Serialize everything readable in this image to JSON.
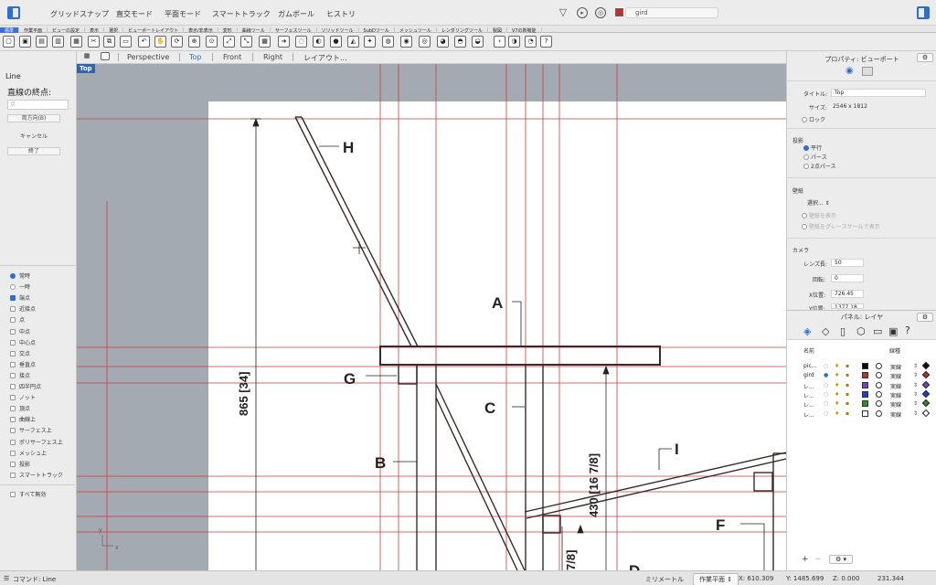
{
  "menubar": {
    "items": [
      "グリッドスナップ",
      "直交モード",
      "平面モード",
      "スマートトラック",
      "ガムボール",
      "ヒストリ"
    ],
    "layer_name": "gird",
    "layer_color": "#c0302a"
  },
  "tabs": [
    "標準",
    "作業平面",
    "ビューの設定",
    "表示",
    "選択",
    "ビューポートレイアウト",
    "表示/非表示",
    "変形",
    "曲線ツール",
    "サーフェスツール",
    "ソリッドツール",
    "SubDツール",
    "メッシュツール",
    "レンダリングツール",
    "製図",
    "V7の新機能"
  ],
  "active_tab_index": 0,
  "viewport_tabs": [
    "Perspective",
    "Top",
    "Front",
    "Right",
    "レイアウト..."
  ],
  "active_viewport_tab": 1,
  "viewport_label": "Top",
  "command_panel": {
    "title": "Line",
    "prompt": "直線の終点:",
    "input_placeholder": "点",
    "both_sides": "両方向(B)",
    "cancel": "キャンセル",
    "finish": "終了"
  },
  "osnaps": [
    {
      "label": "常時",
      "kind": "radio",
      "on": true
    },
    {
      "label": "一時",
      "kind": "radio",
      "on": false
    },
    {
      "label": "端点",
      "kind": "check",
      "on": true
    },
    {
      "label": "近接点",
      "kind": "check",
      "on": false
    },
    {
      "label": "点",
      "kind": "check",
      "on": false
    },
    {
      "label": "中点",
      "kind": "check",
      "on": false
    },
    {
      "label": "中心点",
      "kind": "check",
      "on": false
    },
    {
      "label": "交点",
      "kind": "check",
      "on": false
    },
    {
      "label": "垂直点",
      "kind": "check",
      "on": false
    },
    {
      "label": "接点",
      "kind": "check",
      "on": false
    },
    {
      "label": "四半円点",
      "kind": "check",
      "on": false
    },
    {
      "label": "ノット",
      "kind": "check",
      "on": false
    },
    {
      "label": "頂点",
      "kind": "check",
      "on": false
    },
    {
      "label": "曲線上",
      "kind": "check",
      "on": false
    },
    {
      "label": "サーフェス上",
      "kind": "check",
      "on": false
    },
    {
      "label": "ポリサーフェス上",
      "kind": "check",
      "on": false
    },
    {
      "label": "メッシュ上",
      "kind": "check",
      "on": false
    },
    {
      "label": "投影",
      "kind": "check",
      "on": false
    },
    {
      "label": "スマートトラック",
      "kind": "check",
      "on": false
    }
  ],
  "disable_all": "すべて無効",
  "properties": {
    "header": "プロパティ: ビューポート",
    "title_label": "タイトル:",
    "title_value": "Top",
    "size_label": "サイズ:",
    "size_value": "2546 x 1812",
    "lock_label": "ロック",
    "projection_heading": "投影",
    "projection_options": [
      "平行",
      "パース",
      "2点パース"
    ],
    "projection_selected": 0,
    "wallpaper_heading": "壁紙",
    "wallpaper_select": "選択...",
    "wallpaper_show": "壁紙を表示",
    "wallpaper_gray": "壁紙をグレースケールで表示",
    "camera_heading": "カメラ",
    "lens_label": "レンズ長:",
    "lens_value": "50",
    "rotation_label": "回転:",
    "rotation_value": "0",
    "xpos_label": "X位置:",
    "xpos_value": "726.45",
    "ypos_label": "Y位置:",
    "ypos_value": "1377.18"
  },
  "layers_panel": {
    "header": "パネル: レイヤ",
    "col_name": "名前",
    "col_linetype": "線種",
    "rows": [
      {
        "name": "pic...",
        "color": "#000000",
        "linetype": "実線",
        "current": false,
        "diamond": "#111111"
      },
      {
        "name": "gird",
        "color": "#c0302a",
        "linetype": "実線",
        "current": true,
        "diamond": "#c0302a"
      },
      {
        "name": "レ...",
        "color": "#7b3fc4",
        "linetype": "実線",
        "current": false,
        "diamond": "#7b3fc4"
      },
      {
        "name": "レ...",
        "color": "#1f3fd6",
        "linetype": "実線",
        "current": false,
        "diamond": "#1f3fd6"
      },
      {
        "name": "レ...",
        "color": "#2f8a2a",
        "linetype": "実線",
        "current": false,
        "diamond": "#2f8a2a"
      },
      {
        "name": "レ...",
        "color": "#ffffff",
        "linetype": "実線",
        "current": false,
        "diamond": "#ffffff"
      }
    ]
  },
  "drawing_labels": {
    "H": "H",
    "A": "A",
    "G": "G",
    "C": "C",
    "B": "B",
    "I": "I",
    "F": "F",
    "D": "D",
    "dim1": "865 [34]",
    "dim2": "430 [16 7/8]",
    "dim3": "7/8]"
  },
  "status": {
    "command": "コマンド: Line",
    "units": "ミリメートル",
    "cplane": "作業平面",
    "x": "X: 610.309",
    "y": "Y: 1485.699",
    "z": "Z: 0.000",
    "extra": "231.344"
  }
}
